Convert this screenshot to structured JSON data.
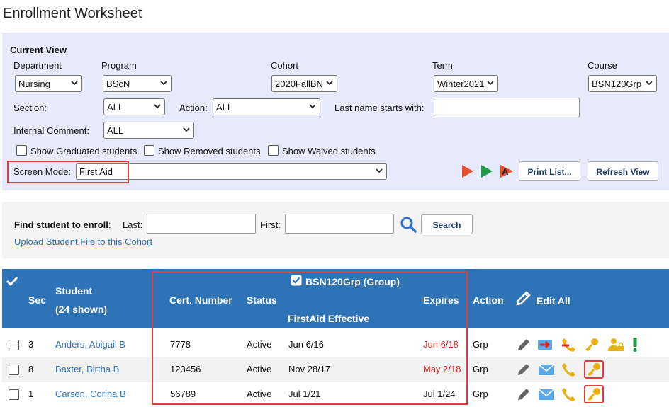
{
  "title": "Enrollment Worksheet",
  "current_view": {
    "heading": "Current View",
    "department": {
      "label": "Department",
      "value": "Nursing"
    },
    "program": {
      "label": "Program",
      "value": "BScN"
    },
    "cohort": {
      "label": "Cohort",
      "value": "2020FallBN"
    },
    "term": {
      "label": "Term",
      "value": "Winter2021"
    },
    "course": {
      "label": "Course",
      "value": "BSN120Grp"
    },
    "section": {
      "label": "Section:",
      "value": "ALL"
    },
    "action": {
      "label": "Action:",
      "value": "ALL"
    },
    "last_name": {
      "label": "Last name starts with:",
      "value": ""
    },
    "internal_comment": {
      "label": "Internal Comment:",
      "value": "ALL"
    },
    "checkboxes": [
      {
        "label": "Show Graduated students",
        "checked": false
      },
      {
        "label": "Show Removed students",
        "checked": false
      },
      {
        "label": "Show Waived students",
        "checked": false
      }
    ],
    "screen_mode": {
      "label": "Screen Mode:",
      "value": "First Aid"
    },
    "print_list_label": "Print List...",
    "refresh_view_label": "Refresh View",
    "icon_colors": {
      "red": "#e8502f",
      "green": "#1e9e4a"
    }
  },
  "find": {
    "label": "Find student to enroll",
    "colon": ":",
    "last_label": "Last:",
    "first_label": "First:",
    "last_value": "",
    "first_value": "",
    "search_label": "Search",
    "upload_link": "Upload Student File to this Cohort"
  },
  "table": {
    "group_label": "BSN120Grp  (Group)",
    "headers": {
      "sec": "Sec",
      "student": "Student",
      "shown": "(24 shown)",
      "cert_number": "Cert. Number",
      "status": "Status",
      "effective": "FirstAid Effective",
      "expires": "Expires",
      "action": "Action",
      "edit_all": "Edit All"
    },
    "rows": [
      {
        "sec": "3",
        "name": "Anders, Abigail B",
        "cert": "7778",
        "status": "Active",
        "effective": "Jun 6/16",
        "expires": "Jun 6/18",
        "expired": true,
        "action": "Grp"
      },
      {
        "sec": "8",
        "name": "Baxter, Birtha B",
        "cert": "123456",
        "status": "Active",
        "effective": "Nov 28/17",
        "expires": "May 2/18",
        "expired": true,
        "action": "Grp"
      },
      {
        "sec": "1",
        "name": "Carsen, Corina B",
        "cert": "56789",
        "status": "Active",
        "effective": "Jul 1/21",
        "expires": "Jul 1/24",
        "expired": false,
        "action": "Grp"
      }
    ]
  },
  "colors": {
    "header_bg": "#2e73b6",
    "link": "#2f74b8",
    "expired": "#e02424",
    "highlight": "#e23c3c"
  }
}
